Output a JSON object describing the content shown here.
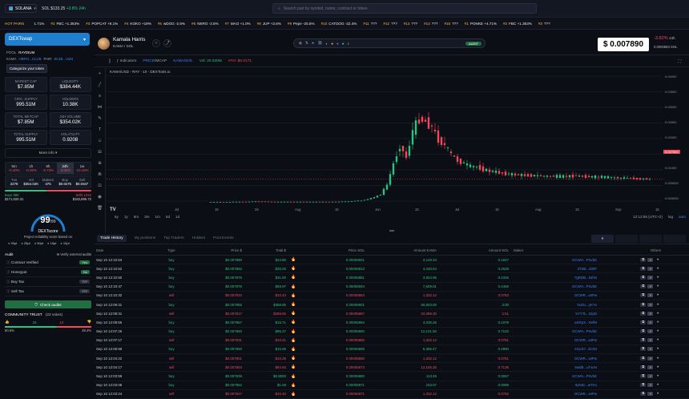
{
  "topbar": {
    "chain": "SOLANA",
    "sol_price": "SOL $133.25",
    "sol_change": "+3.8% 24h",
    "search_placeholder": "Search pair by symbol, name, contract or token"
  },
  "ticker": [
    {
      "label": "HOT PAIRS",
      "sym": "",
      "chg": ""
    },
    {
      "label": "",
      "sym": "1.71%",
      "chg": "up"
    },
    {
      "label": "#2",
      "sym": "FBC +1.353%",
      "chg": "up"
    },
    {
      "label": "#3",
      "sym": "POPCAT +8.1%",
      "chg": "up"
    },
    {
      "label": "#4",
      "sym": "KOKO +19%",
      "chg": "up"
    },
    {
      "label": "#5",
      "sym": "wDOG -2.6%",
      "chg": "dn"
    },
    {
      "label": "#6",
      "sym": "NERO -2.5%",
      "chg": "dn"
    },
    {
      "label": "#7",
      "sym": "MAO +1.0%",
      "chg": "up"
    },
    {
      "label": "#8",
      "sym": "JUP +3.6%",
      "chg": "up"
    },
    {
      "label": "#9",
      "sym": "Pepe -25.5%",
      "chg": "dn"
    },
    {
      "label": "#10",
      "sym": "CATDOG -22.4%",
      "chg": "dn"
    },
    {
      "label": "#11",
      "sym": "???",
      "chg": ""
    },
    {
      "label": "#12",
      "sym": "???",
      "chg": ""
    },
    {
      "label": "#13",
      "sym": "???",
      "chg": ""
    },
    {
      "label": "#14",
      "sym": "???",
      "chg": ""
    },
    {
      "label": "#15",
      "sym": "???",
      "chg": ""
    },
    {
      "label": "#1",
      "sym": "PONKE +4.71%",
      "chg": "up"
    },
    {
      "label": "#2",
      "sym": "FBC +1.353%",
      "chg": "up"
    },
    {
      "label": "#3",
      "sym": "???",
      "chg": ""
    }
  ],
  "left": {
    "dex_button": "DEXTswap",
    "pool_label": "POOL",
    "pool_value": "RAYDIUM",
    "token_label": "KAMA",
    "token_value": "HBRO...CLUB",
    "pair_label": "PAIR",
    "pair_value": "8C4B...VoM",
    "categorize": "Categorize your token",
    "stats": [
      {
        "label": "MARKET CAP",
        "value": "$7.85M"
      },
      {
        "label": "LIQUIDITY",
        "value": "$384.44K"
      },
      {
        "label": "CIRC. SUPPLY",
        "value": "995.51M"
      },
      {
        "label": "HOLDERS",
        "value": "10.38K"
      },
      {
        "label": "TOTAL MKTCAP",
        "value": "$7.85M"
      },
      {
        "label": "24H VOLUME",
        "value": "$354.02K"
      },
      {
        "label": "TOTAL SUPPLY",
        "value": "995.51M"
      },
      {
        "label": "VOLATILITY",
        "value": "0.9208"
      }
    ],
    "more_info": "More info",
    "timeframes": [
      {
        "label": "5m",
        "chg": "-0.40%"
      },
      {
        "label": "1h",
        "chg": "-0.28%"
      },
      {
        "label": "6h",
        "chg": "-5.73%"
      },
      {
        "label": "24h",
        "chg": "-3.82%"
      },
      {
        "label": "1w",
        "chg": "-10.15%"
      }
    ],
    "tx_headers": [
      "Txs",
      "Vol",
      "Makers",
      "Buy",
      "Sell"
    ],
    "tx_values": [
      "2278",
      "$354.02K",
      "475",
      "$0.0s75",
      "$0.0s67"
    ],
    "buys_label": "Buys 996",
    "buys_value": "$171,020.31",
    "sells_label": "Sells 1322",
    "sells_value": "$182,895.72",
    "score": "99",
    "score_max": "/99",
    "score_name": "DEXTscore",
    "score_sub": "Project reliability score based on",
    "score_items": [
      "90pt",
      "25pt",
      "50pt",
      "15pt",
      "10pt"
    ],
    "audit_title": "Audit",
    "audit_link": "Verify external audits",
    "audit": [
      {
        "label": "Contract Verified",
        "value": "Yes"
      },
      {
        "label": "Honeypot",
        "value": "No"
      },
      {
        "label": "Buy Tax",
        "value": "???"
      },
      {
        "label": "Sell Tax",
        "value": "???"
      }
    ],
    "check_audits": "Check audits",
    "community": "COMMUNITY TRUST",
    "votes": "(22 votes)",
    "trust_up": "60.6%",
    "trust_down": "39.4%",
    "up_count": "10",
    "down_count": "10"
  },
  "token": {
    "name": "Kamala Harris",
    "symbol": "KAMA",
    "quote": "SOL",
    "price": "$ 0.007890",
    "change": "-3.82%",
    "change_period": "24h",
    "price_sol": "0.0000583 SOL",
    "links_badge": "AUDIT"
  },
  "toolbar": {
    "indicators": "Indicators",
    "tabs": [
      "PRICE",
      "MCAP"
    ],
    "pair": "KAMA/SOL",
    "vol": "Vol: 20.030M",
    "ath": "ATH: $0.0171"
  },
  "chart_legend": "KAMA/USD - RAY - 10 - DEXTools.io",
  "chart_data": {
    "type": "candlestick",
    "x_ticks": [
      "Jul",
      "15",
      "29",
      "Aug",
      "15",
      "Jun",
      "15",
      "Jul",
      "15",
      "Aug",
      "15",
      "Sep",
      "15"
    ],
    "y_ticks": [
      "0.04000",
      "0.03500",
      "0.03000",
      "0.02500",
      "0.02000",
      "0.01500",
      "0.01000",
      "0.005000",
      "0.000000"
    ],
    "last_price": "0.007890",
    "series_shape": [
      0.0002,
      0.0002,
      0.0002,
      0.0002,
      0.0003,
      0.0003,
      0.0003,
      0.0004,
      0.0004,
      0.0004,
      0.0003,
      0.0003,
      0.0003,
      0.0003,
      0.0003,
      0.0003,
      0.0003,
      0.0003,
      0.0003,
      0.0003,
      0.0003,
      0.0004,
      0.0004,
      0.0006,
      0.0007,
      0.0012,
      0.0018,
      0.0028,
      0.006,
      0.013,
      0.019,
      0.015,
      0.024,
      0.028,
      0.027,
      0.025,
      0.021,
      0.019,
      0.016,
      0.014,
      0.013,
      0.012,
      0.012,
      0.011,
      0.0105,
      0.0102,
      0.0098,
      0.0095,
      0.0093,
      0.0092,
      0.0091,
      0.009,
      0.0089,
      0.0088,
      0.0088,
      0.0087,
      0.0088,
      0.0089,
      0.0088,
      0.0087,
      0.0086,
      0.0086,
      0.0085,
      0.0084,
      0.0083,
      0.0082,
      0.0081,
      0.008,
      0.0079,
      0.0079
    ]
  },
  "range": {
    "items": [
      "5y",
      "1y",
      "6m",
      "3m",
      "1m",
      "5d",
      "1d"
    ],
    "time": "12:12:56 (UTC+2)",
    "log": "log",
    "auto": "auto"
  },
  "tabs": [
    "Trade History",
    "My positions",
    "Top Traders",
    "Holders",
    "Pool Events"
  ],
  "table": {
    "headers": [
      "Date",
      "Type",
      "Price $",
      "Total $",
      "",
      "Price SOL",
      "Amount KAMA",
      "Amount SOL",
      "Maker",
      "Others"
    ],
    "rows": [
      [
        "Sep 10 12:10:53",
        "buy",
        "$0.007880",
        "$24.80",
        "0.00005901",
        "3,129.34",
        "0.1847",
        "GCWH...PXvbE"
      ],
      [
        "Sep 10 12:10:52",
        "buy",
        "$0.007882",
        "$35.00",
        "0.00005913",
        "4,440.54",
        "0.2628",
        "3TZB...330F"
      ],
      [
        "Sep 10 12:10:50",
        "buy",
        "$0.007876",
        "$31.00",
        "0.00005881",
        "3,934.95",
        "0.2326",
        "7gRDB...k4hN"
      ],
      [
        "Sep 10 12:10:47",
        "buy",
        "$0.007876",
        "$59.97",
        "0.00005584",
        "7,609.01",
        "0.4468",
        "GCWH...PXvbE"
      ],
      [
        "Sep 10 12:10:32",
        "sell",
        "$0.007834",
        "$10.43",
        "0.00005864",
        "1,332.12",
        "0.0783",
        "DCWR...wtPw"
      ],
      [
        "Sep 10 12:09:31",
        "buy",
        "$0.007856",
        "$398.85",
        "0.00005901",
        "50,803.00",
        "3.00",
        "7aGU...yKYv"
      ],
      [
        "Sep 10 12:08:31",
        "sell",
        "$0.007817",
        "$268.65",
        "0.00005887",
        "34,388.30",
        "2.01",
        "5YYTs...3JpD"
      ],
      [
        "Sep 10 12:08:55",
        "buy",
        "$0.007857",
        "$15.71",
        "0.00005884",
        "4,036.26",
        "0.2379",
        "aKRpX...NvfM"
      ],
      [
        "Sep 10 12:07:26",
        "buy",
        "$0.007860",
        "$95.27",
        "0.00005860",
        "12,121.50",
        "0.7102",
        "GCWH...PXvbE"
      ],
      [
        "Sep 10 12:07:17",
        "sell",
        "$0.007831",
        "$10.41",
        "0.00005860",
        "1,332.12",
        "0.0781",
        "DCWR...wtPw"
      ],
      [
        "Sep 10 12:06:58",
        "buy",
        "$0.007850",
        "$10.06",
        "0.00005895",
        "8,365.47",
        "0.4950",
        "4GuS7...EckN"
      ],
      [
        "Sep 10 12:04:22",
        "sell",
        "$0.007801",
        "$10.39",
        "0.00005860",
        "1,332.12",
        "0.0781",
        "DCWR...wtPw"
      ],
      [
        "Sep 10 12:04:17",
        "sell",
        "$0.007804",
        "$94.93",
        "0.00005873",
        "12,165.30",
        "0.7136",
        "5wdB...uTxeN"
      ],
      [
        "Sep 10 12:03:59",
        "buy",
        "$0.007839",
        "$0.8000",
        "0.00005880",
        "113.49",
        "0.0067",
        "GCWH...PXvbE"
      ],
      [
        "Sep 10 12:03:08",
        "buy",
        "$0.007852",
        "$1.08",
        "0.00005871",
        "153.07",
        "0.0089",
        "9yN3z...wTKs"
      ],
      [
        "Sep 10 12:03:24",
        "sell",
        "$0.007817",
        "$10.40",
        "0.00005871",
        "1,332.12",
        "0.0782",
        "DCWR...wtPw"
      ]
    ]
  },
  "colors": {
    "bg": "#0b0e14",
    "up": "#2ec27e",
    "down": "#f04a5a",
    "accent": "#1e7fcf"
  }
}
